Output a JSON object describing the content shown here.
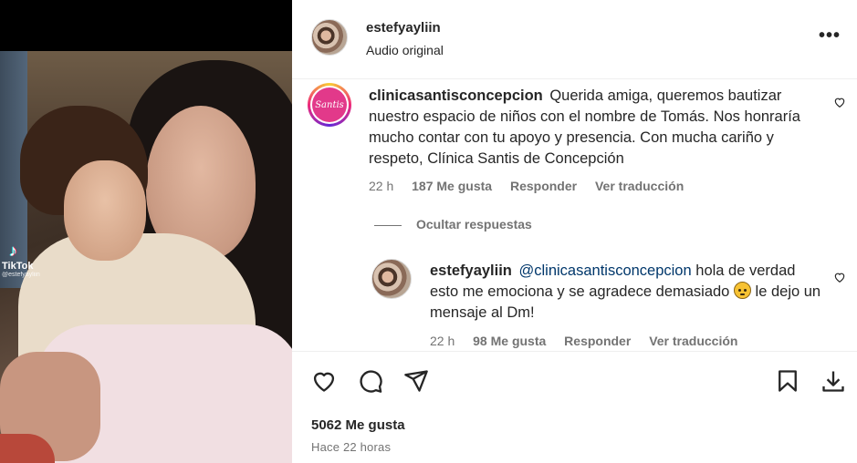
{
  "post": {
    "owner_username": "estefyayliin",
    "audio_label": "Audio original",
    "watermark": {
      "brand": "TikTok",
      "handle": "@estefyayliin"
    }
  },
  "comments": [
    {
      "username": "clinicasantisconcepcion",
      "avatar_text": "Santis",
      "text": "Querida amiga, queremos bautizar nuestro espacio de niños con el nombre de Tomás. Nos honraría mucho contar con tu apoyo y presencia. Con mucha cariño y respeto, Clínica Santis de Concepción",
      "time": "22 h",
      "likes": "187 Me gusta",
      "reply_label": "Responder",
      "translate_label": "Ver traducción"
    }
  ],
  "hide_replies_label": "Ocultar respuestas",
  "reply": {
    "username": "estefyayliin",
    "mention": "@clinicasantisconcepcion",
    "text_before_emoji": "hola de verdad esto me emociona y se agradece demasiado",
    "emoji_name": "pleading-face",
    "text_after_emoji": "le dejo un mensaje al Dm!",
    "time": "22 h",
    "likes": "98 Me gusta",
    "reply_label": "Responder",
    "translate_label": "Ver traducción"
  },
  "footer": {
    "likes_count": "5062 Me gusta",
    "posted_ago": "Hace 22 horas"
  },
  "icons": [
    "more-options-icon",
    "heart-icon",
    "comment-icon",
    "share-icon",
    "save-icon",
    "download-icon"
  ]
}
